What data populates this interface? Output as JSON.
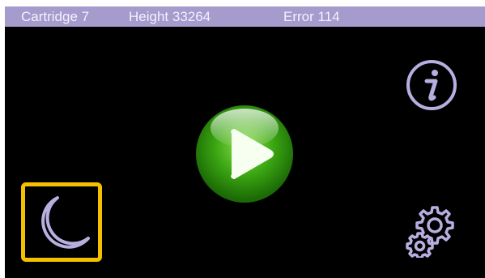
{
  "status_bar": {
    "cartridge": "Cartridge 7",
    "height": "Height 33264",
    "error": "Error 114"
  },
  "buttons": {
    "info": {
      "icon": "info-icon"
    },
    "play": {
      "icon": "play-icon"
    },
    "night_mode": {
      "icon": "moon-icon",
      "selected": true
    },
    "settings": {
      "icon": "gears-icon"
    }
  },
  "colors": {
    "status_bar_bg": "#a59bcc",
    "icon_lavender": "#b8aee0",
    "play_green": "#2f9a10",
    "selection_yellow": "#f5c000",
    "screen_bg": "#000000"
  }
}
